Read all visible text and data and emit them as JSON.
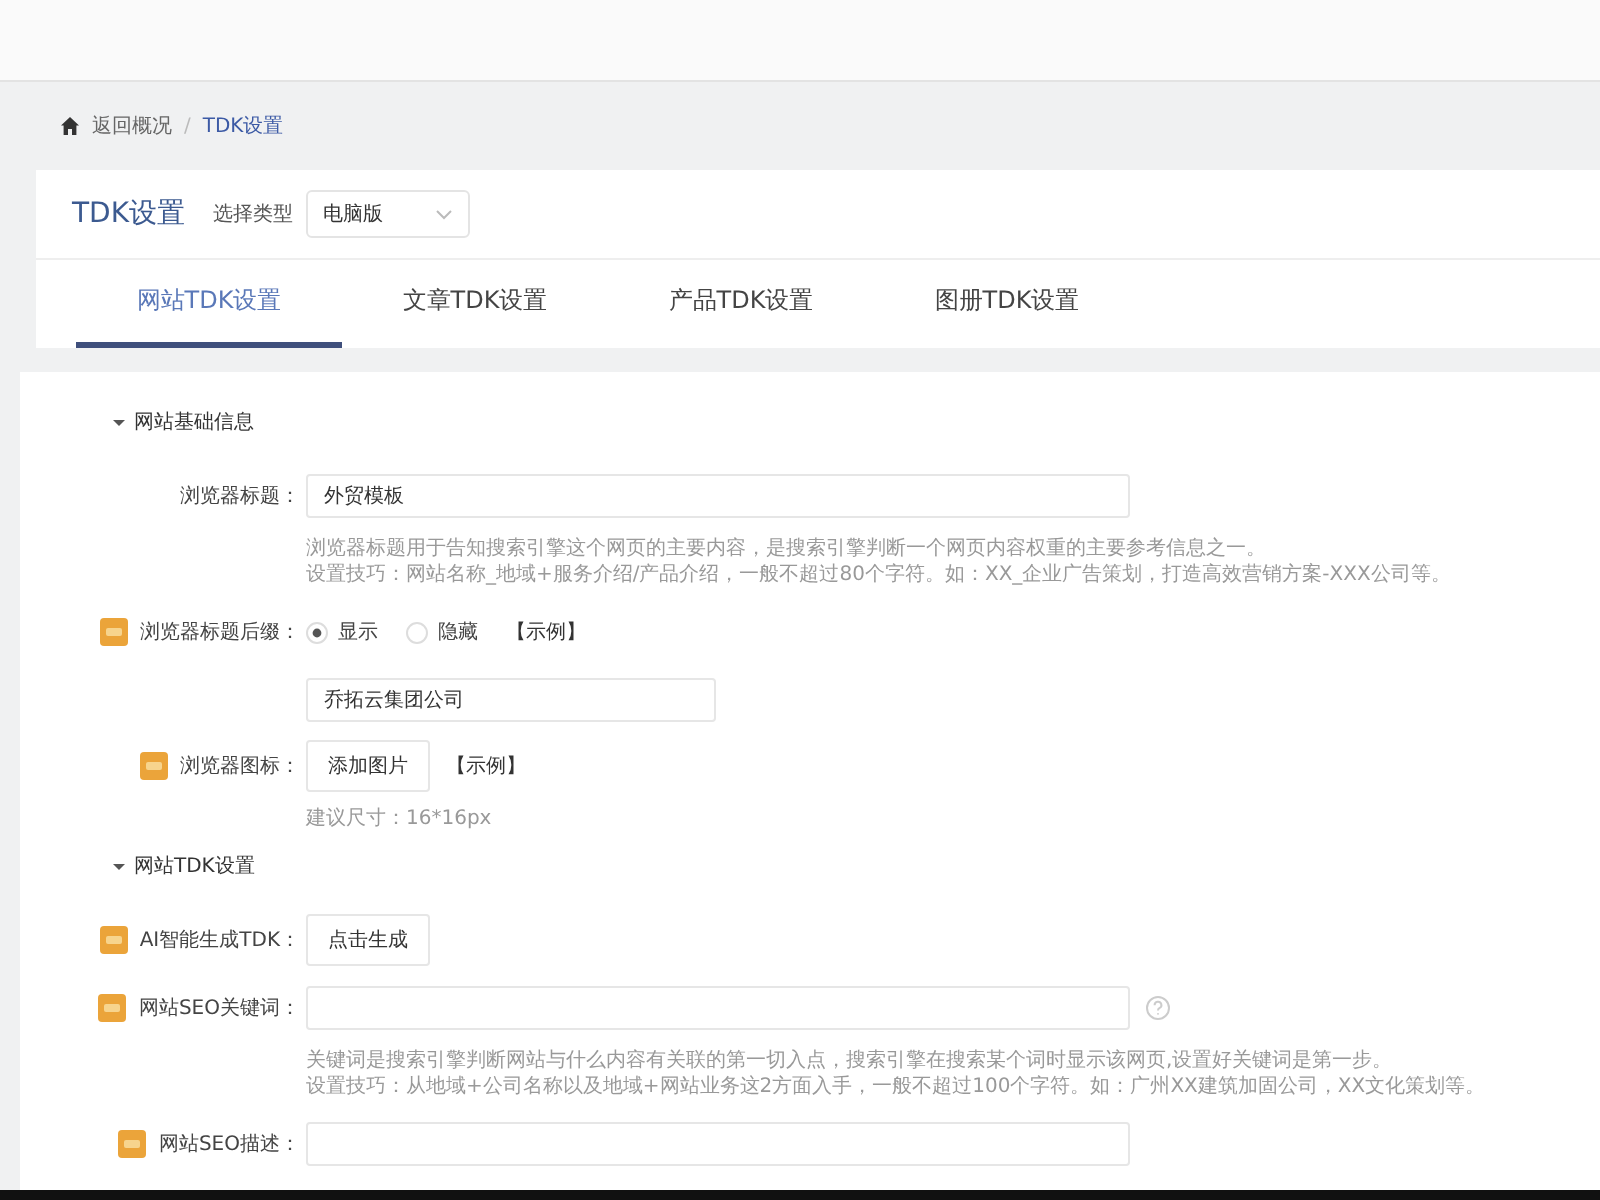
{
  "breadcrumb": [
    {
      "label": "返回概况",
      "kind": "home"
    },
    {
      "label": "TDK设置",
      "kind": "current"
    }
  ],
  "breadcrumb_separator": "/",
  "header": {
    "title": "TDK设置",
    "type_label": "选择类型",
    "select_value": "电脑版"
  },
  "tabs": [
    {
      "label": "网站TDK设置",
      "selected": true
    },
    {
      "label": "文章TDK设置",
      "selected": false
    },
    {
      "label": "产品TDK设置",
      "selected": false
    },
    {
      "label": "图册TDK设置",
      "selected": false
    }
  ],
  "sections": [
    {
      "title": "网站基础信息",
      "expanded": true,
      "rows": [
        {
          "kind": "input",
          "badge": false,
          "label": "浏览器标题：",
          "value": "外贸模板",
          "help": false,
          "hints": [
            "浏览器标题用于告知搜索引擎这个网页的主要内容，是搜索引擎判断一个网页内容权重的主要参考信息之一。",
            "设置技巧：网站名称_地域+服务介绍/产品介绍，一般不超过80个字符。如：XX_企业广告策划，打造高效营销方案-XXX公司等。"
          ]
        },
        {
          "kind": "radio",
          "badge": true,
          "label": "浏览器标题后缀：",
          "options": [
            {
              "label": "显示",
              "selected": true
            },
            {
              "label": "隐藏",
              "selected": false
            }
          ],
          "link": "【示例】",
          "value": "乔拓云集团公司"
        },
        {
          "kind": "button",
          "badge": true,
          "label": "浏览器图标：",
          "button": "添加图片",
          "link": "【示例】",
          "hints": [
            "建议尺寸：16*16px"
          ]
        }
      ]
    },
    {
      "title": "网站TDK设置",
      "expanded": true,
      "rows": [
        {
          "kind": "button",
          "badge": true,
          "label": "AI智能生成TDK：",
          "button": "点击生成"
        },
        {
          "kind": "input",
          "badge": true,
          "label": "网站SEO关键词：",
          "value": "",
          "help": true,
          "hints": [
            "关键词是搜索引擎判断网站与什么内容有关联的第一切入点，搜索引擎在搜索某个词时显示该网页,设置好关键词是第一步。",
            "设置技巧：从地域+公司名称以及地域+网站业务这2方面入手，一般不超过100个字符。如：广州XX建筑加固公司，XX文化策划等。"
          ]
        },
        {
          "kind": "input",
          "badge": true,
          "label": "网站SEO描述：",
          "value": "",
          "help": false
        }
      ]
    }
  ]
}
